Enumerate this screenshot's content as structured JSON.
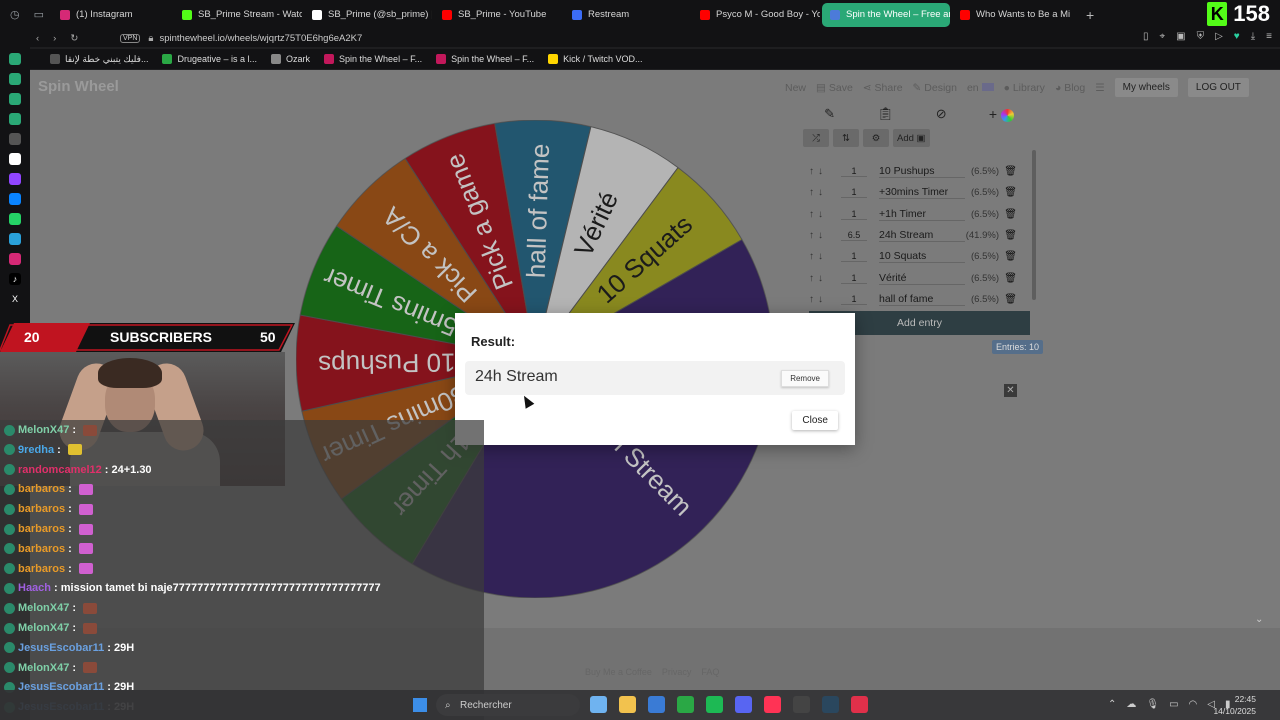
{
  "tabs": [
    {
      "label": "(1) Instagram",
      "color": "#d62976"
    },
    {
      "label": "SB_Prime Stream - Watc",
      "color": "#53fc18"
    },
    {
      "label": "SB_Prime (@sb_prime) |",
      "color": "#ffffff"
    },
    {
      "label": "SB_Prime - YouTube",
      "color": "#ff0000"
    },
    {
      "label": "Restream",
      "color": "#3b6cf6"
    },
    {
      "label": "Psyco M - Good Boy - Yo",
      "color": "#ff0000"
    },
    {
      "label": "Spin the Wheel – Free an",
      "color": "#4c7bd9",
      "active": true
    },
    {
      "label": "Who Wants to Be a Mi",
      "color": "#ff0000"
    }
  ],
  "kick_viewers": "158",
  "address": {
    "vpn": "VPN",
    "url": "spinthewheel.io/wheels/wjqrtz75T0E6hg6eA2K7"
  },
  "bookmarks": [
    {
      "label": "فليك يتبني خطة لإنقا...",
      "color": "#555555"
    },
    {
      "label": "Drugeative – is a l...",
      "color": "#2aa845"
    },
    {
      "label": "Ozark",
      "color": "#888888"
    },
    {
      "label": "Spin the Wheel – F...",
      "color": "#c2185b"
    },
    {
      "label": "Spin the Wheel – F...",
      "color": "#c2185b"
    },
    {
      "label": "Kick / Twitch VOD...",
      "color": "#ffd600"
    }
  ],
  "site": {
    "logo": "Spin Wheel",
    "nav": [
      "New",
      "Save",
      "Share",
      "Design",
      "en",
      "Library",
      "Blog"
    ],
    "my_wheels": "My wheels",
    "logout": "LOG OUT"
  },
  "editor": {
    "add_image": "Add",
    "entries": [
      {
        "weight": "1",
        "label": "10 Pushups",
        "pct": "(6.5%)"
      },
      {
        "weight": "1",
        "label": "+30mins Timer",
        "pct": "(6.5%)"
      },
      {
        "weight": "1",
        "label": "+1h Timer",
        "pct": "(6.5%)"
      },
      {
        "weight": "6.5",
        "label": "24h Stream",
        "pct": "(41.9%)"
      },
      {
        "weight": "1",
        "label": "10 Squats",
        "pct": "(6.5%)"
      },
      {
        "weight": "1",
        "label": "Vérité",
        "pct": "(6.5%)"
      },
      {
        "weight": "1",
        "label": "hall of fame",
        "pct": "(6.5%)"
      }
    ],
    "add_entry": "Add entry",
    "entries_count": "Entries: 10"
  },
  "wheel": {
    "segments": [
      {
        "label": "24h Stream",
        "color": "#3d2a6b",
        "share": 0.419
      },
      {
        "label": "+1h Timer",
        "color": "#1d7a1d",
        "share": 0.0645
      },
      {
        "label": "+30mins Timer",
        "color": "#a8581a",
        "share": 0.0645
      },
      {
        "label": "10 Pushups",
        "color": "#a31823",
        "share": 0.0645
      },
      {
        "label": "15mins Timer",
        "color": "#1d7a1d",
        "share": 0.0645
      },
      {
        "label": "Pick a C/A",
        "color": "#a8581a",
        "share": 0.0645
      },
      {
        "label": "Pick a game",
        "color": "#a31823",
        "share": 0.0645
      },
      {
        "label": "hall of fame",
        "color": "#2a6a88",
        "share": 0.0645
      },
      {
        "label": "Vérité",
        "color": "#dcdcdc",
        "share": 0.0645
      },
      {
        "label": "10 Squats",
        "color": "#a8a826",
        "share": 0.0645
      }
    ]
  },
  "dialog": {
    "title": "Result:",
    "result": "24h Stream",
    "remove": "Remove",
    "close": "Close"
  },
  "footer": {
    "coffee": "Buy Me a Coffee",
    "privacy": "Privacy",
    "faq": "FAQ"
  },
  "overlay": {
    "subs_current": "20",
    "subs_label": "SUBSCRIBERS",
    "subs_goal": "50"
  },
  "chat": [
    {
      "user": "MelonX47",
      "color": "#7fd0a8",
      "text": ":",
      "emote": "#8a4a3a"
    },
    {
      "user": "9redha",
      "color": "#4aa8e8",
      "text": ":",
      "emote": "#e0c030"
    },
    {
      "user": "randomcamel12",
      "color": "#e0306a",
      "text": ": 24+1.30",
      "emote": ""
    },
    {
      "user": "barbaros",
      "color": "#e89a28",
      "text": ":",
      "emote": "#d060d0"
    },
    {
      "user": "barbaros",
      "color": "#e89a28",
      "text": ":",
      "emote": "#d060d0"
    },
    {
      "user": "barbaros",
      "color": "#e89a28",
      "text": ":",
      "emote": "#d060d0"
    },
    {
      "user": "barbaros",
      "color": "#e89a28",
      "text": ":",
      "emote": "#d060d0"
    },
    {
      "user": "barbaros",
      "color": "#e89a28",
      "text": ":",
      "emote": "#d060d0"
    },
    {
      "user": "Haach",
      "color": "#a060e0",
      "text": ": mission tamet bi naje7777777777777777777777777777777777",
      "emote": ""
    },
    {
      "user": "MelonX47",
      "color": "#7fd0a8",
      "text": ":",
      "emote": "#8a4a3a"
    },
    {
      "user": "MelonX47",
      "color": "#7fd0a8",
      "text": ":",
      "emote": "#8a4a3a"
    },
    {
      "user": "JesusEscobar11",
      "color": "#6aa0e0",
      "text": ": 29H",
      "emote": ""
    },
    {
      "user": "MelonX47",
      "color": "#7fd0a8",
      "text": ":",
      "emote": "#8a4a3a"
    },
    {
      "user": "JesusEscobar11",
      "color": "#6aa0e0",
      "text": ": 29H",
      "emote": ""
    },
    {
      "user": "JesusEscobar11",
      "color": "#6aa0e0",
      "text": ": 29H",
      "emote": ""
    }
  ],
  "taskbar": {
    "search": "Rechercher",
    "time": "22:45",
    "date": "14/10/2025",
    "apps": [
      "#6fb3f0",
      "#f2c24e",
      "#3a7bd5",
      "#2aa845",
      "#1db954",
      "#5865f2",
      "#ff3355",
      "#444444",
      "#2a475e",
      "#e0304a"
    ]
  }
}
